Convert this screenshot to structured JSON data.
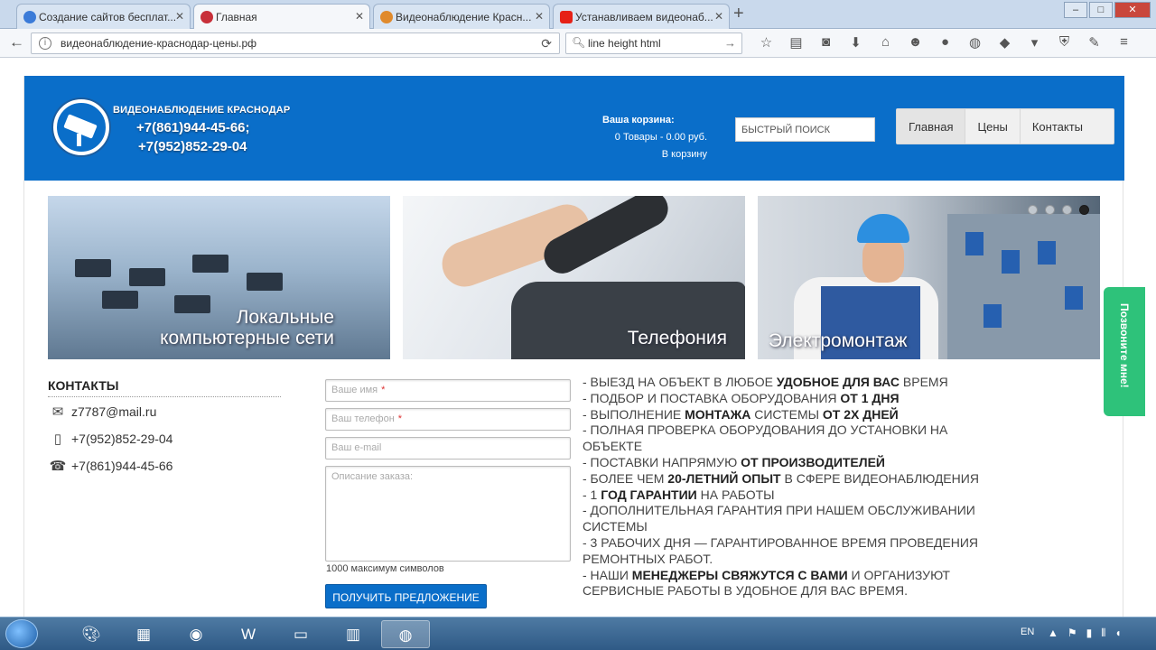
{
  "browser": {
    "tabs": [
      {
        "title": "Создание сайтов бесплат...",
        "icon": "globe-icon",
        "color": "#3b7bd8"
      },
      {
        "title": "Главная",
        "icon": "checkmark-icon",
        "color": "#c8303a"
      },
      {
        "title": "Видеонаблюдение Красн...",
        "icon": "joomla-icon",
        "color": "#e08a2c"
      },
      {
        "title": "Устанавливаем видеонаб...",
        "icon": "youtube-icon",
        "color": "#e62117"
      }
    ],
    "url": "видеонаблюдение-краснодар-цены.рф",
    "search_value": "line height html"
  },
  "header": {
    "company": "ВИДЕОНАБЛЮДЕНИЕ КРАСНОДАР",
    "phone1": "+7(861)944-45-66;",
    "phone2": "+7(952)852-29-04",
    "cart_title": "Ваша корзина:",
    "cart_summary": "0 Товары - 0.00 руб.",
    "cart_link": "В корзину",
    "quick_search": "БЫСТРЫЙ ПОИСК",
    "nav": [
      "Главная",
      "Цены",
      "Контакты"
    ]
  },
  "banners": [
    {
      "line1": "Локальные",
      "line2": "компьютерные сети"
    },
    {
      "line1": "Телефония",
      "line2": ""
    },
    {
      "line1": "Электромонтаж",
      "line2": ""
    }
  ],
  "contacts": {
    "heading": "КОНТАКТЫ",
    "email": "z7787@mail.ru",
    "mobile": "+7(952)852-29-04",
    "landline": "+7(861)944-45-66"
  },
  "form": {
    "name_placeholder": "Ваше имя",
    "phone_placeholder": "Ваш телефон",
    "email_placeholder": "Ваш e-mail",
    "desc_placeholder": "Описание заказа:",
    "max_chars": "1000 максимум символов",
    "submit": "ПОЛУЧИТЬ ПРЕДЛОЖЕНИЕ",
    "required_mark": "*"
  },
  "benefits": [
    [
      "- ВЫЕЗД НА ОБЪЕКТ В ЛЮБОЕ ",
      "УДОБНОЕ ДЛЯ ВАС",
      " ВРЕМЯ"
    ],
    [
      "- ПОДБОР И ПОСТАВКА ОБОРУДОВАНИЯ ",
      "ОТ 1 ДНЯ",
      ""
    ],
    [
      "- ВЫПОЛНЕНИЕ ",
      "МОНТАЖА",
      " СИСТЕМЫ ",
      "ОТ 2Х ДНЕЙ"
    ],
    [
      "- ПОЛНАЯ ПРОВЕРКА ОБОРУДОВАНИЯ ДО УСТАНОВКИ НА ОБЪЕКТЕ"
    ],
    [
      "- ПОСТАВКИ НАПРЯМУЮ ",
      "ОТ ПРОИЗВОДИТЕЛЕЙ",
      ""
    ],
    [
      "- БОЛЕЕ ЧЕМ ",
      "20-ЛЕТНИЙ ОПЫТ",
      " В СФЕРЕ ВИДЕОНАБЛЮДЕНИЯ"
    ],
    [
      "- 1 ",
      "ГОД ГАРАНТИИ",
      " НА РАБОТЫ"
    ],
    [
      "- ДОПОЛНИТЕЛЬНАЯ ГАРАНТИЯ ПРИ НАШЕМ ОБСЛУЖИВАНИИ СИСТЕМЫ"
    ],
    [
      "- 3 РАБОЧИХ ДНЯ — ГАРАНТИРОВАННОЕ ВРЕМЯ ПРОВЕДЕНИЯ РЕМОНТНЫХ РАБОТ."
    ],
    [
      "- НАШИ ",
      "МЕНЕДЖЕРЫ СВЯЖУТСЯ С ВАМИ",
      " И ОРГАНИЗУЮТ СЕРВИСНЫЕ РАБОТЫ В УДОБНОЕ ДЛЯ ВАС ВРЕМЯ."
    ]
  ],
  "call_button": "Позвоните мне!",
  "taskbar": {
    "lang": "EN",
    "apps": [
      "paint-icon",
      "excel-icon",
      "chrome-icon",
      "word-icon",
      "notepad-icon",
      "chart-icon",
      "firefox-icon"
    ]
  },
  "colors": {
    "brand_blue": "#0a6ec9",
    "call_green": "#2ec27a"
  }
}
